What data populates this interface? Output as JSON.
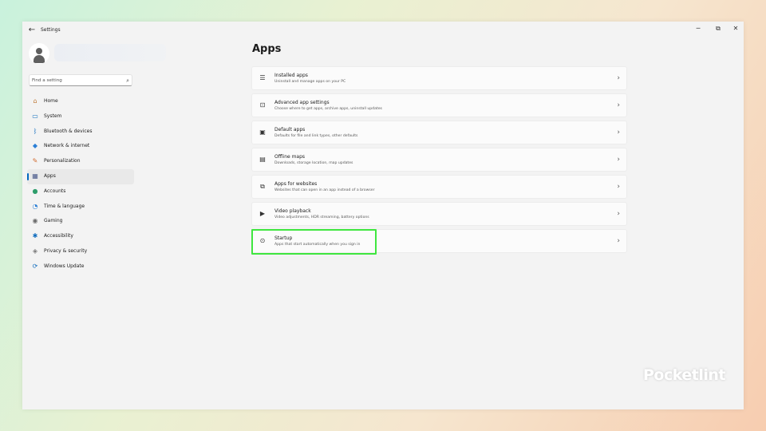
{
  "window": {
    "title": "Settings",
    "back_icon": "back-arrow-icon",
    "controls": {
      "minimize": "─",
      "maximize": "⧉",
      "close": "✕"
    }
  },
  "search": {
    "placeholder": "Find a setting",
    "value": ""
  },
  "sidebar": {
    "items": [
      {
        "label": "Home",
        "icon": "home-icon",
        "glyph": "⌂",
        "color": "#c07a3a"
      },
      {
        "label": "System",
        "icon": "monitor-icon",
        "glyph": "▭",
        "color": "#0f6cbd"
      },
      {
        "label": "Bluetooth & devices",
        "icon": "bluetooth-icon",
        "glyph": "ᛒ",
        "color": "#0f6cbd"
      },
      {
        "label": "Network & internet",
        "icon": "wifi-icon",
        "glyph": "◆",
        "color": "#2b7fd6"
      },
      {
        "label": "Personalization",
        "icon": "brush-icon",
        "glyph": "✎",
        "color": "#d26b2f"
      },
      {
        "label": "Apps",
        "icon": "apps-icon",
        "glyph": "▦",
        "color": "#4a5a8a"
      },
      {
        "label": "Accounts",
        "icon": "person-icon",
        "glyph": "●",
        "color": "#2e9d6b"
      },
      {
        "label": "Time & language",
        "icon": "globe-clock-icon",
        "glyph": "◔",
        "color": "#2b7fd6"
      },
      {
        "label": "Gaming",
        "icon": "gamepad-icon",
        "glyph": "◉",
        "color": "#6a6a6a"
      },
      {
        "label": "Accessibility",
        "icon": "accessibility-icon",
        "glyph": "✱",
        "color": "#0f6cbd"
      },
      {
        "label": "Privacy & security",
        "icon": "shield-icon",
        "glyph": "◈",
        "color": "#7a7a7a"
      },
      {
        "label": "Windows Update",
        "icon": "update-icon",
        "glyph": "⟳",
        "color": "#0f6cbd"
      }
    ],
    "active_index": 5
  },
  "main": {
    "title": "Apps",
    "cards": [
      {
        "title": "Installed apps",
        "desc": "Uninstall and manage apps on your PC",
        "icon": "list-icon",
        "glyph": "☰"
      },
      {
        "title": "Advanced app settings",
        "desc": "Choose where to get apps, archive apps, uninstall updates",
        "icon": "app-settings-icon",
        "glyph": "⊡"
      },
      {
        "title": "Default apps",
        "desc": "Defaults for file and link types, other defaults",
        "icon": "default-apps-icon",
        "glyph": "▣"
      },
      {
        "title": "Offline maps",
        "desc": "Downloads, storage location, map updates",
        "icon": "map-icon",
        "glyph": "▤"
      },
      {
        "title": "Apps for websites",
        "desc": "Websites that can open in an app instead of a browser",
        "icon": "link-app-icon",
        "glyph": "⧉"
      },
      {
        "title": "Video playback",
        "desc": "Video adjustments, HDR streaming, battery options",
        "icon": "video-icon",
        "glyph": "▶"
      },
      {
        "title": "Startup",
        "desc": "Apps that start automatically when you sign in",
        "icon": "startup-icon",
        "glyph": "⊙"
      }
    ],
    "highlighted_index": 6,
    "highlight_color": "#3fe63f"
  },
  "watermark": {
    "text": "Pocketlint"
  }
}
